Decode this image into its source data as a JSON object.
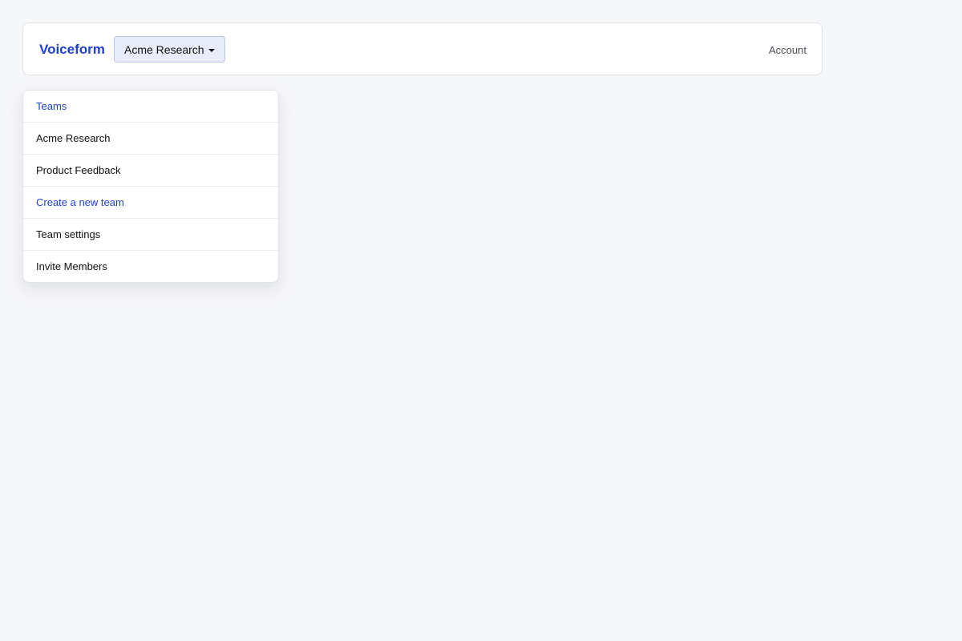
{
  "navbar": {
    "brand": "Voiceform",
    "team_switcher_label": "Acme Research",
    "account_label": "Account"
  },
  "dropdown": {
    "items": [
      {
        "label": "Teams",
        "style": "accent"
      },
      {
        "label": "Acme Research",
        "style": "normal"
      },
      {
        "label": "Product Feedback",
        "style": "normal"
      },
      {
        "label": "Create a new team",
        "style": "accent"
      },
      {
        "label": "Team settings",
        "style": "normal"
      },
      {
        "label": "Invite Members",
        "style": "normal"
      }
    ]
  },
  "colors": {
    "accent": "#1f3fd1",
    "background": "#f6f7f9",
    "switcher_bg": "#e8ecfb"
  }
}
